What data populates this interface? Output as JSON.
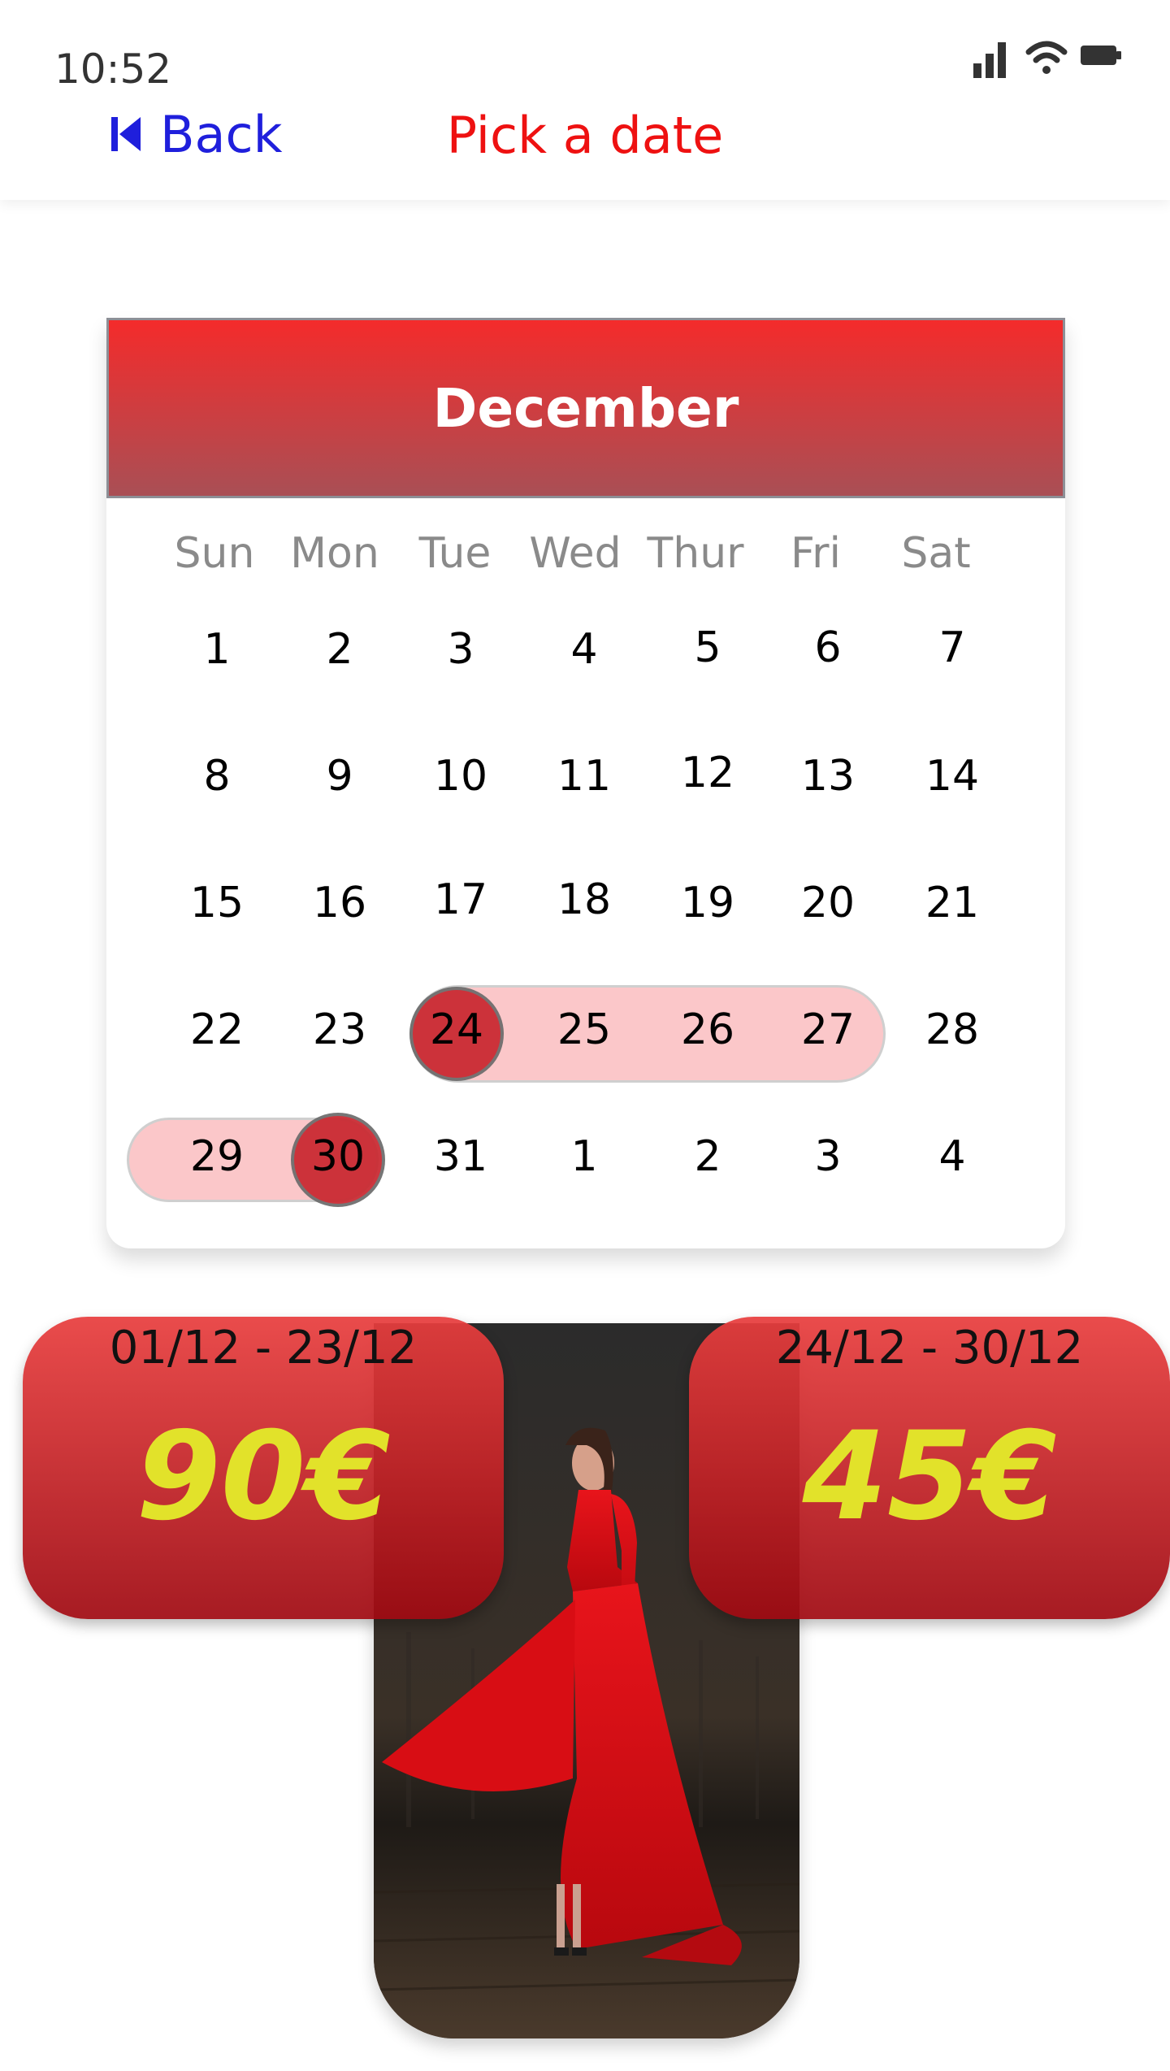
{
  "status_bar": {
    "time": "10:52",
    "icons": [
      "signal-icon",
      "wifi-icon",
      "battery-icon"
    ]
  },
  "header": {
    "back_label": "Back",
    "title": "Pick a date"
  },
  "calendar": {
    "month": "December",
    "weekdays": [
      "Sun",
      "Mon",
      "Tue",
      "Wed",
      "Thur",
      "Fri",
      "Sat"
    ],
    "weeks": [
      [
        "1",
        "2",
        "3",
        "4",
        "5",
        "6",
        "7"
      ],
      [
        "8",
        "9",
        "10",
        "11",
        "12",
        "13",
        "14"
      ],
      [
        "15",
        "16",
        "17",
        "18",
        "19",
        "20",
        "21"
      ],
      [
        "22",
        "23",
        "24",
        "25",
        "26",
        "27",
        "28"
      ],
      [
        "29",
        "30",
        "31",
        "1",
        "2",
        "3",
        "4"
      ]
    ],
    "selected_range": {
      "start": "24",
      "end": "30"
    }
  },
  "pricing": [
    {
      "range": "01/12 - 23/12",
      "price": "90€"
    },
    {
      "range": "24/12 - 30/12",
      "price": "45€"
    }
  ],
  "colors": {
    "accent": "#ee1111",
    "link": "#1f1fdc",
    "price_text": "#e2e22a",
    "range_fill": "#fbc7c9",
    "selected_day": "#c9262e"
  }
}
